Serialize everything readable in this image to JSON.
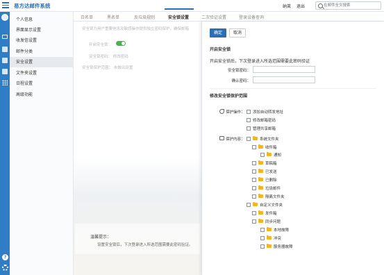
{
  "app": {
    "title": "易方达邮件系统",
    "links": [
      "纳莱",
      "退出"
    ],
    "search_placeholder": "在邮件全文搜索"
  },
  "rail": {
    "icons": [
      "avatar-icon",
      "mail-icon",
      "contacts-icon",
      "calendar-icon",
      "notes-icon",
      "apps-grid-icon",
      "help-icon",
      "settings-icon"
    ]
  },
  "sidebar": {
    "items": [
      {
        "label": "个人信息",
        "active": false
      },
      {
        "label": "界面显示设置",
        "active": false
      },
      {
        "label": "收发信设置",
        "active": false
      },
      {
        "label": "邮件分类",
        "active": false
      },
      {
        "label": "安全设置",
        "active": true
      },
      {
        "label": "文件夹设置",
        "active": false
      },
      {
        "label": "日程设置",
        "active": false
      },
      {
        "label": "高级功能",
        "active": false
      }
    ]
  },
  "tabs": [
    {
      "label": "白名单",
      "active": false
    },
    {
      "label": "黑名单",
      "active": false
    },
    {
      "label": "反垃圾规则",
      "active": false
    },
    {
      "label": "安全锁设置",
      "active": true
    },
    {
      "label": "二次验证设置",
      "active": false
    },
    {
      "label": "登录设备查询",
      "active": false
    }
  ],
  "background": {
    "intro": "安全锁为用户重要信息及敏感操作提供独立密码保护，确保邮箱",
    "lock_label": "开启安全锁：",
    "old_pwd": "安全锁密码：   修改密码",
    "new_pwd": "安全锁保护范围：   未做出设置",
    "note_title": "温馨提示：",
    "note_text": "设置安全锁后，下次登录进入所选范围需要此密码验证。"
  },
  "panel": {
    "confirm_label": "确定",
    "cancel_label": "取消",
    "enable_title": "开启安全锁",
    "enable_desc": "开启安全锁后，下次登录进入所选范围需要此密码验证",
    "pwd_label": "安全锁密码：",
    "confirm_pwd_label": "确认密码：",
    "scope_title": "修改安全锁保护范围",
    "ops_label": "保护操作：",
    "ops": [
      "添加自动转发地址",
      "修改邮箱密码",
      "管理共享邮箱"
    ],
    "content_label": "保护内容：",
    "system_folders_label": "系统文件夹",
    "system_folders": [
      {
        "label": "收件箱",
        "children": [
          "通知"
        ]
      },
      {
        "label": "草稿箱",
        "children": []
      },
      {
        "label": "已发送",
        "children": []
      },
      {
        "label": "已删除",
        "children": []
      },
      {
        "label": "垃圾邮件",
        "children": []
      },
      {
        "label": "隔离文件夹",
        "children": []
      }
    ],
    "custom_folders_label": "自定义文件夹",
    "custom_folders": [
      {
        "label": "发件箱",
        "children": []
      },
      {
        "label": "同步问题",
        "children": [
          "本地故障",
          "冲突",
          "服务器故障"
        ]
      }
    ]
  },
  "colors": {
    "accent": "#2a6fb4",
    "rail": "#2f7dc4",
    "folder": "#f3b623",
    "toggle_on": "#4caf50"
  }
}
